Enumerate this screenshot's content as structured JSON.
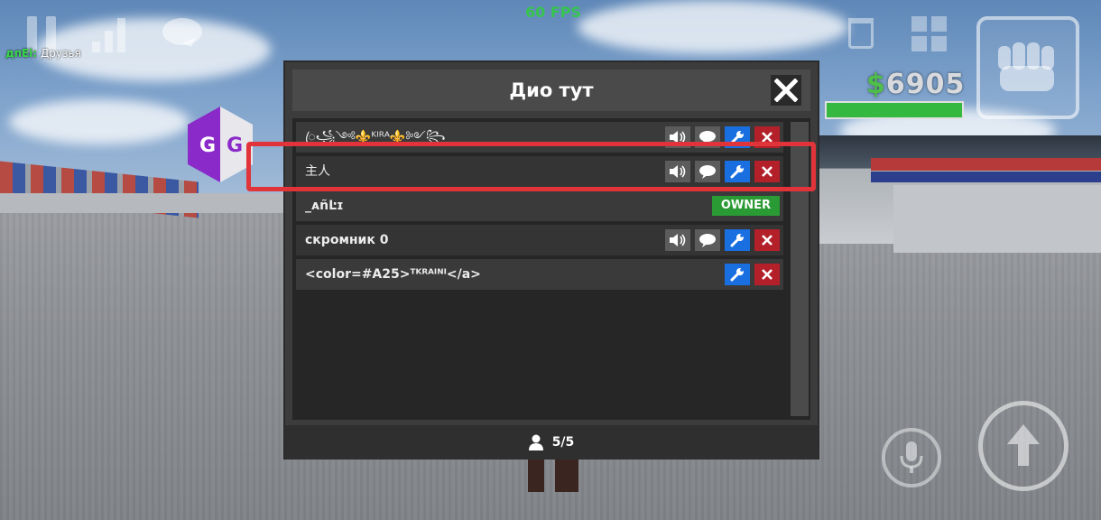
{
  "hud": {
    "fps": "60 FPS",
    "friends_tag": "дпЕі:",
    "friends_label": "Друзья",
    "money_symbol": "$",
    "money_value": "6905",
    "health_fraction": 1.0,
    "gg_logo_text": "GG"
  },
  "panel": {
    "title": "Дио тут",
    "players": [
      {
        "name": "ꦿ꧁༺⚜️ᴷᴵᴿᴬ⚜️༻꧂",
        "actions": [
          "mute",
          "chat",
          "admin",
          "kick"
        ]
      },
      {
        "name": "主人",
        "actions": [
          "mute",
          "chat",
          "admin",
          "kick"
        ]
      },
      {
        "name": "_ᴀñĿɪ",
        "badge": "OWNER"
      },
      {
        "name": "скромник 0",
        "actions": [
          "mute",
          "chat",
          "admin",
          "kick"
        ]
      },
      {
        "name": "<color=#A25>ᵀᴷᴿᴬᴵᴺᴵ</a>",
        "actions": [
          "admin",
          "kick"
        ]
      }
    ],
    "player_count": "5/5"
  },
  "colors": {
    "highlight": "#e0343a",
    "owner_badge": "#2a9a35",
    "admin_button": "#1a6fe0",
    "kick_button": "#b3202a",
    "fps": "#2fcf3a"
  },
  "icons": [
    "pause-icon",
    "signal-icon",
    "chat-bubble-icon",
    "trash-icon",
    "grid-icon",
    "fist-icon",
    "mic-icon",
    "arrow-up-icon",
    "close-icon",
    "speaker-icon",
    "wrench-icon",
    "user-icon"
  ]
}
